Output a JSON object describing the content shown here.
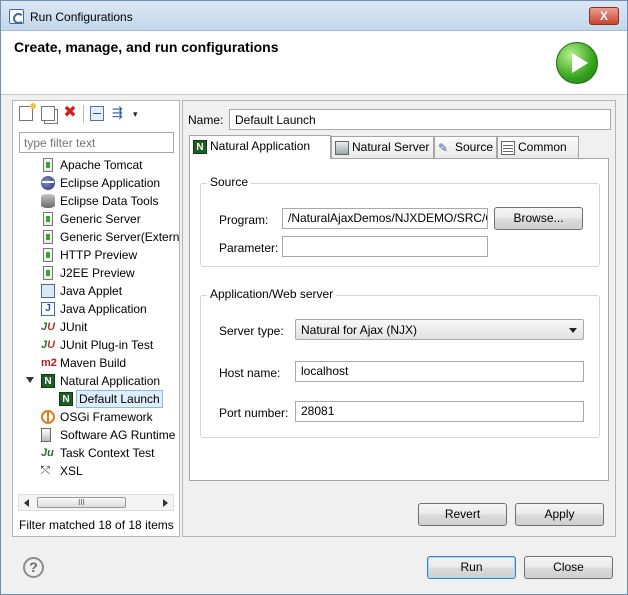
{
  "window": {
    "title": "Run Configurations",
    "close_label": "X"
  },
  "header": {
    "heading": "Create, manage, and run configurations"
  },
  "left": {
    "filter_placeholder": "type filter text",
    "menu_arrow": "▾",
    "items": [
      {
        "label": "Apache Tomcat",
        "icon": "doc-icon"
      },
      {
        "label": "Eclipse Application",
        "icon": "eclipse-icon"
      },
      {
        "label": "Eclipse Data Tools",
        "icon": "database-icon"
      },
      {
        "label": "Generic Server",
        "icon": "doc-icon"
      },
      {
        "label": "Generic Server(Extern",
        "icon": "doc-icon"
      },
      {
        "label": "HTTP Preview",
        "icon": "doc-icon"
      },
      {
        "label": "J2EE Preview",
        "icon": "doc-icon"
      },
      {
        "label": "Java Applet",
        "icon": "applet-icon"
      },
      {
        "label": "Java Application",
        "icon": "java-app-icon"
      },
      {
        "label": "JUnit",
        "icon": "junit-icon"
      },
      {
        "label": "JUnit Plug-in Test",
        "icon": "junit-icon"
      },
      {
        "label": "Maven Build",
        "icon": "maven-icon"
      },
      {
        "label": "Natural Application",
        "icon": "natural-icon"
      },
      {
        "label": "Default Launch",
        "icon": "natural-icon"
      },
      {
        "label": "OSGi Framework",
        "icon": "osgi-icon"
      },
      {
        "label": "Software AG Runtime",
        "icon": "sag-icon"
      },
      {
        "label": "Task Context Test",
        "icon": "task-icon"
      },
      {
        "label": "XSL",
        "icon": "xsl-icon"
      }
    ],
    "status": "Filter matched 18 of 18 items",
    "scroll_thumb": "III"
  },
  "right": {
    "name_label": "Name:",
    "name_value": "Default Launch",
    "tabs": [
      {
        "label": "Natural Application",
        "icon": "natural-icon"
      },
      {
        "label": "Natural Server",
        "icon": "server-icon"
      },
      {
        "label": "Source",
        "icon": "source-icon"
      },
      {
        "label": "Common",
        "icon": "common-icon"
      }
    ],
    "source": {
      "title": "Source",
      "program_label": "Program:",
      "program_value": "/NaturalAjaxDemos/NJXDEMO/SRC/C",
      "browse_label": "Browse...",
      "parameter_label": "Parameter:",
      "parameter_value": ""
    },
    "server": {
      "title": "Application/Web server",
      "server_type_label": "Server type:",
      "server_type_value": "Natural for Ajax (NJX)",
      "host_label": "Host name:",
      "host_value": "localhost",
      "port_label": "Port number:",
      "port_value": "28081"
    },
    "revert_label": "Revert",
    "apply_label": "Apply"
  },
  "footer": {
    "help_symbol": "?",
    "run_label": "Run",
    "close_label": "Close"
  }
}
